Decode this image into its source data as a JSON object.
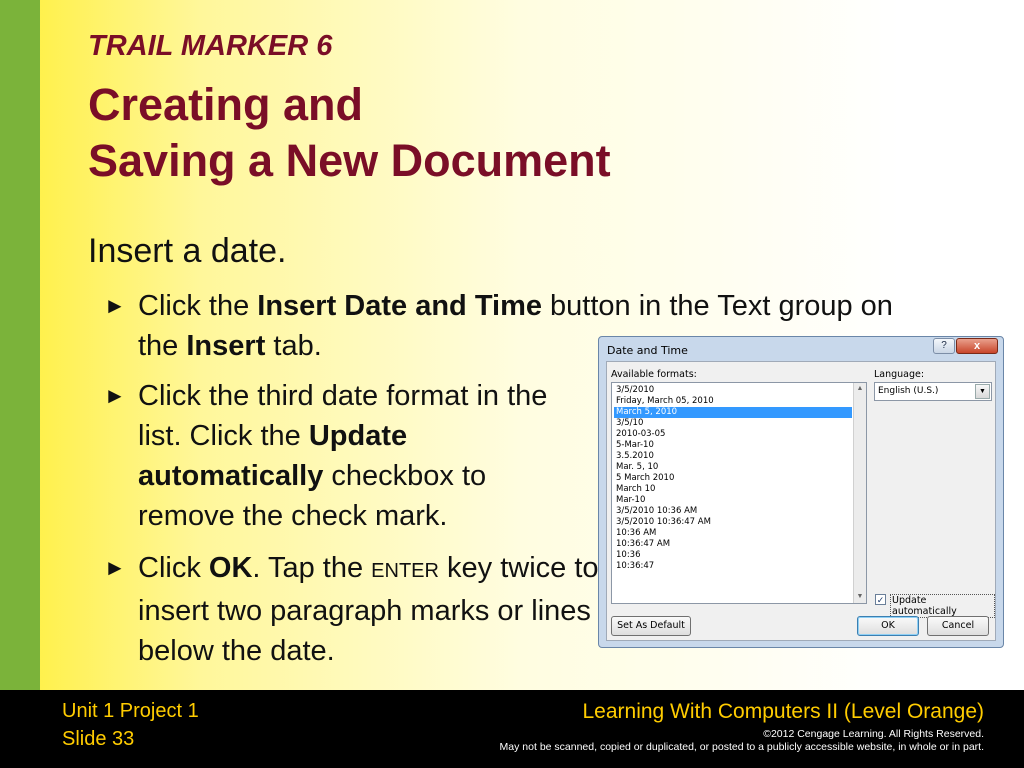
{
  "slide": {
    "marker": "TRAIL MARKER 6",
    "title_line1": "Creating and",
    "title_line2": "Saving a New Document",
    "subhead": "Insert a date.",
    "bullet_arrow": "►",
    "bullets": [
      {
        "parts": [
          "Click the ",
          "Insert Date and Time",
          " button in the Text group on the ",
          "Insert",
          " tab."
        ]
      },
      {
        "parts": [
          "Click the third date format in the list. Click the ",
          "Update automatically",
          " checkbox to remove the check mark."
        ]
      },
      {
        "parts": [
          "Click ",
          "OK",
          ".  Tap the ",
          "ENTER",
          " key twice to insert two paragraph marks or lines below the date."
        ]
      }
    ]
  },
  "dialog": {
    "title": "Date and Time",
    "help_label": "?",
    "close_label": "x",
    "formats_label": "Available formats:",
    "formats": [
      "3/5/2010",
      "Friday, March 05, 2010",
      "March 5, 2010",
      "3/5/10",
      "2010-03-05",
      "5-Mar-10",
      "3.5.2010",
      "Mar. 5, 10",
      "5 March 2010",
      "March 10",
      "Mar-10",
      "3/5/2010 10:36 AM",
      "3/5/2010 10:36:47 AM",
      "10:36 AM",
      "10:36:47 AM",
      "10:36",
      "10:36:47"
    ],
    "selected_index": 2,
    "language_label": "Language:",
    "language_value": "English (U.S.)",
    "update_label": "Update automatically",
    "update_checked": true,
    "set_default_label": "Set As Default",
    "ok_label": "OK",
    "cancel_label": "Cancel"
  },
  "footer": {
    "unit": "Unit 1 Project 1",
    "slide": "Slide 33",
    "course": "Learning With Computers II (Level Orange)",
    "copyright": "©2012 Cengage Learning. All Rights Reserved.",
    "rights": "May not be scanned, copied or duplicated, or posted to a publicly accessible website, in whole or in part."
  },
  "colors": {
    "title": "#7a0e27",
    "accent_bar": "#7bb33a",
    "footer_text": "#ffcc00",
    "list_selection": "#3399ff"
  }
}
